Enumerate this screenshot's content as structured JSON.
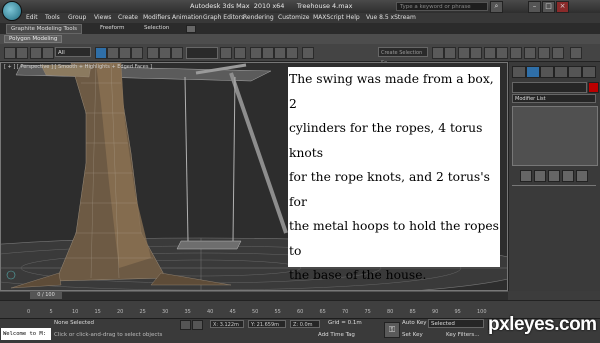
{
  "window": {
    "title": "Autodesk 3ds Max  2010 x64      Treehouse 4.max",
    "search_placeholder": "Type a keyword or phrase"
  },
  "menu": [
    "Edit",
    "Tools",
    "Group",
    "Views",
    "Create",
    "Modifiers",
    "Animation",
    "Graph Editors",
    "Rendering",
    "Customize",
    "MAXScript",
    "Help",
    "Vue 8.5 xStream"
  ],
  "ribbon": {
    "tabs": [
      "Graphite Modeling Tools",
      "Freeform",
      "Selection"
    ],
    "panel_tab": "Polygon Modeling"
  },
  "toolbar": {
    "filter": "All",
    "named_selection_placeholder": "Create Selection Se"
  },
  "viewport": {
    "label": "[ + ] [ Perspective ] [ Smooth + Highlights + Edged Faces ]",
    "caption": [
      "The swing was made from a box, 2",
      "cylinders for the ropes, 4 torus knots",
      "for the rope knots, and 2 torus's for",
      "the metal hoops to hold the ropes to",
      "the base of the house."
    ]
  },
  "command_panel": {
    "modifier_list": "Modifier List"
  },
  "timeline": {
    "frame": "0 / 100",
    "ticks": [
      "0",
      "5",
      "10",
      "15",
      "20",
      "25",
      "30",
      "35",
      "40",
      "45",
      "50",
      "55",
      "60",
      "65",
      "70",
      "75",
      "80",
      "85",
      "90",
      "95",
      "100"
    ]
  },
  "status": {
    "welcome": "Welcome to M:",
    "selection": "None Selected",
    "hint": "Click or click-and-drag to select objects",
    "x": "X: 3.122m",
    "y": "Y: 21.659m",
    "z": "Z: 0.0m",
    "grid": "Grid = 0.1m",
    "add_time_tag": "Add Time Tag",
    "auto_key": "Auto Key",
    "set_key": "Set Key",
    "selected": "Selected",
    "key_filters": "Key Filters..."
  },
  "watermark": "pxleyes.com"
}
